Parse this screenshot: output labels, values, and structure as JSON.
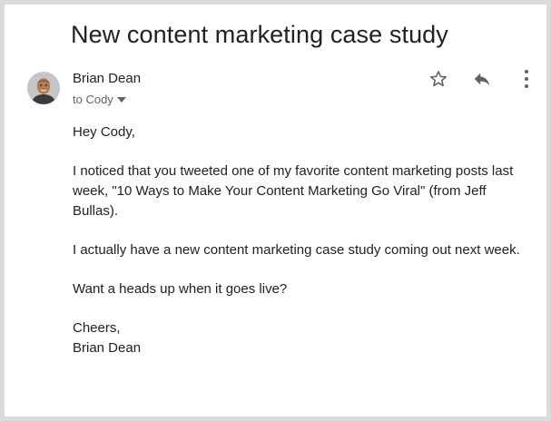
{
  "email": {
    "subject": "New content marketing case study",
    "sender": {
      "name": "Brian Dean",
      "avatar_icon": "person-avatar-icon"
    },
    "recipient_label": "to Cody",
    "actions": {
      "star_icon": "star-outline-icon",
      "reply_icon": "reply-icon",
      "more_icon": "more-vertical-icon"
    },
    "body": {
      "greeting": "Hey Cody,",
      "paragraph1": "I noticed that you tweeted one of my favorite content marketing posts last week, \"10 Ways to Make Your Content Marketing Go Viral\" (from Jeff Bullas).",
      "paragraph2": "I actually have a new content marketing case study coming out next week.",
      "paragraph3": "Want a heads up when it goes live?",
      "signoff": "Cheers,",
      "signature": "Brian Dean"
    }
  },
  "colors": {
    "text": "#202124",
    "secondary_text": "#5f6368",
    "icon": "#5f6368",
    "frame_border": "#dcdcdc"
  }
}
